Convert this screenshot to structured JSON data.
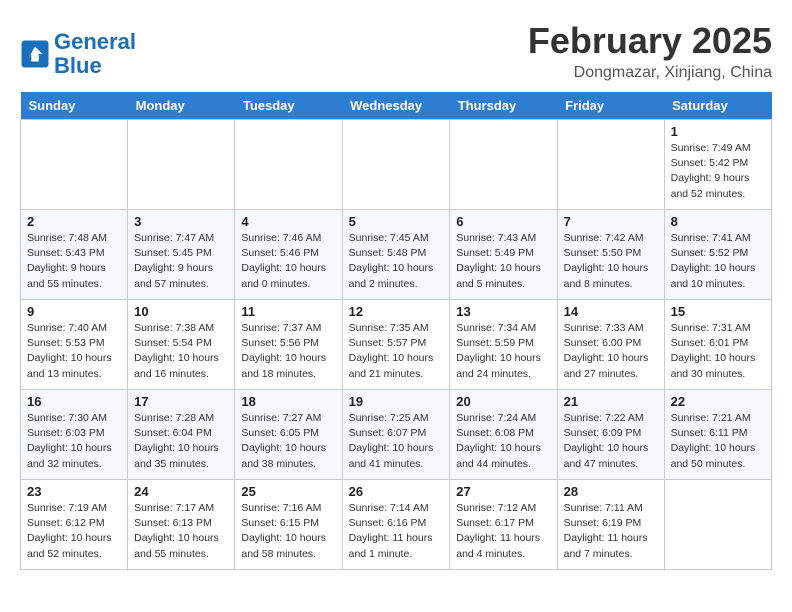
{
  "header": {
    "logo_line1": "General",
    "logo_line2": "Blue",
    "month": "February 2025",
    "location": "Dongmazar, Xinjiang, China"
  },
  "weekdays": [
    "Sunday",
    "Monday",
    "Tuesday",
    "Wednesday",
    "Thursday",
    "Friday",
    "Saturday"
  ],
  "weeks": [
    [
      {
        "day": "",
        "info": ""
      },
      {
        "day": "",
        "info": ""
      },
      {
        "day": "",
        "info": ""
      },
      {
        "day": "",
        "info": ""
      },
      {
        "day": "",
        "info": ""
      },
      {
        "day": "",
        "info": ""
      },
      {
        "day": "1",
        "info": "Sunrise: 7:49 AM\nSunset: 5:42 PM\nDaylight: 9 hours and 52 minutes."
      }
    ],
    [
      {
        "day": "2",
        "info": "Sunrise: 7:48 AM\nSunset: 5:43 PM\nDaylight: 9 hours and 55 minutes."
      },
      {
        "day": "3",
        "info": "Sunrise: 7:47 AM\nSunset: 5:45 PM\nDaylight: 9 hours and 57 minutes."
      },
      {
        "day": "4",
        "info": "Sunrise: 7:46 AM\nSunset: 5:46 PM\nDaylight: 10 hours and 0 minutes."
      },
      {
        "day": "5",
        "info": "Sunrise: 7:45 AM\nSunset: 5:48 PM\nDaylight: 10 hours and 2 minutes."
      },
      {
        "day": "6",
        "info": "Sunrise: 7:43 AM\nSunset: 5:49 PM\nDaylight: 10 hours and 5 minutes."
      },
      {
        "day": "7",
        "info": "Sunrise: 7:42 AM\nSunset: 5:50 PM\nDaylight: 10 hours and 8 minutes."
      },
      {
        "day": "8",
        "info": "Sunrise: 7:41 AM\nSunset: 5:52 PM\nDaylight: 10 hours and 10 minutes."
      }
    ],
    [
      {
        "day": "9",
        "info": "Sunrise: 7:40 AM\nSunset: 5:53 PM\nDaylight: 10 hours and 13 minutes."
      },
      {
        "day": "10",
        "info": "Sunrise: 7:38 AM\nSunset: 5:54 PM\nDaylight: 10 hours and 16 minutes."
      },
      {
        "day": "11",
        "info": "Sunrise: 7:37 AM\nSunset: 5:56 PM\nDaylight: 10 hours and 18 minutes."
      },
      {
        "day": "12",
        "info": "Sunrise: 7:35 AM\nSunset: 5:57 PM\nDaylight: 10 hours and 21 minutes."
      },
      {
        "day": "13",
        "info": "Sunrise: 7:34 AM\nSunset: 5:59 PM\nDaylight: 10 hours and 24 minutes."
      },
      {
        "day": "14",
        "info": "Sunrise: 7:33 AM\nSunset: 6:00 PM\nDaylight: 10 hours and 27 minutes."
      },
      {
        "day": "15",
        "info": "Sunrise: 7:31 AM\nSunset: 6:01 PM\nDaylight: 10 hours and 30 minutes."
      }
    ],
    [
      {
        "day": "16",
        "info": "Sunrise: 7:30 AM\nSunset: 6:03 PM\nDaylight: 10 hours and 32 minutes."
      },
      {
        "day": "17",
        "info": "Sunrise: 7:28 AM\nSunset: 6:04 PM\nDaylight: 10 hours and 35 minutes."
      },
      {
        "day": "18",
        "info": "Sunrise: 7:27 AM\nSunset: 6:05 PM\nDaylight: 10 hours and 38 minutes."
      },
      {
        "day": "19",
        "info": "Sunrise: 7:25 AM\nSunset: 6:07 PM\nDaylight: 10 hours and 41 minutes."
      },
      {
        "day": "20",
        "info": "Sunrise: 7:24 AM\nSunset: 6:08 PM\nDaylight: 10 hours and 44 minutes."
      },
      {
        "day": "21",
        "info": "Sunrise: 7:22 AM\nSunset: 6:09 PM\nDaylight: 10 hours and 47 minutes."
      },
      {
        "day": "22",
        "info": "Sunrise: 7:21 AM\nSunset: 6:11 PM\nDaylight: 10 hours and 50 minutes."
      }
    ],
    [
      {
        "day": "23",
        "info": "Sunrise: 7:19 AM\nSunset: 6:12 PM\nDaylight: 10 hours and 52 minutes."
      },
      {
        "day": "24",
        "info": "Sunrise: 7:17 AM\nSunset: 6:13 PM\nDaylight: 10 hours and 55 minutes."
      },
      {
        "day": "25",
        "info": "Sunrise: 7:16 AM\nSunset: 6:15 PM\nDaylight: 10 hours and 58 minutes."
      },
      {
        "day": "26",
        "info": "Sunrise: 7:14 AM\nSunset: 6:16 PM\nDaylight: 11 hours and 1 minute."
      },
      {
        "day": "27",
        "info": "Sunrise: 7:12 AM\nSunset: 6:17 PM\nDaylight: 11 hours and 4 minutes."
      },
      {
        "day": "28",
        "info": "Sunrise: 7:11 AM\nSunset: 6:19 PM\nDaylight: 11 hours and 7 minutes."
      },
      {
        "day": "",
        "info": ""
      }
    ]
  ]
}
